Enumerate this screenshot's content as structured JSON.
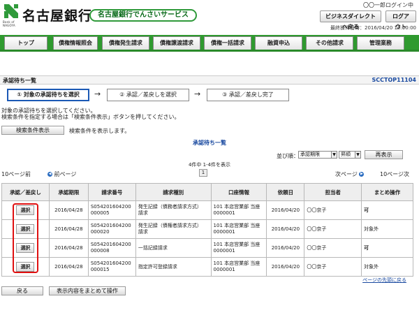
{
  "header": {
    "bank_name": "名古屋銀行",
    "logo_sub_en": "Bank of",
    "logo_sub_en2": "NAGOYA",
    "service_name": "名古屋銀行でんさいサービス",
    "user_line": "〇〇一郎ログイン中",
    "btn_business": "ビジネスダイレクトへ戻る",
    "btn_logout": "ログアウト",
    "last_operation": "最終操作日時：2016/04/20 10:00:00"
  },
  "nav": {
    "tabs": [
      "トップ",
      "債権情報照会",
      "債権発生請求",
      "債権譲渡請求",
      "債権一括請求",
      "融資申込",
      "その他請求",
      "管理業務"
    ]
  },
  "title": {
    "text": "承認待ち一覧",
    "screen_id": "SCCTOP11104"
  },
  "steps": {
    "step1": "① 対象の承認待ちを選択",
    "step2": "② 承認／差戻しを選択",
    "step3": "③ 承認／差戻し完了",
    "arrow": "→"
  },
  "instructions": {
    "line1": "対象の承認待ちを選択してください。",
    "line2": "検索条件を指定する場合は「検索条件表示」ボタンを押してください。"
  },
  "search": {
    "button": "検索条件表示",
    "note": "検索条件を表示します。"
  },
  "list": {
    "title": "承認待ち一覧",
    "sort_label": "並び順：",
    "sort_field": "承認期限",
    "sort_order": "昇順",
    "redisplay": "再表示",
    "count": "4件中 1-4件を表示",
    "page": "1",
    "prev10": "10ページ前",
    "prev": "前ページ",
    "next": "次ページ",
    "next10": "10ページ次",
    "columns": [
      "承認／差戻し",
      "承認期限",
      "請求番号",
      "請求種別",
      "口座情報",
      "依頼日",
      "担当者",
      "まとめ操作"
    ],
    "select_label": "選択",
    "rows": [
      {
        "deadline": "2016/04/28",
        "req_no1": "S054201604200",
        "req_no2": "000005",
        "type1": "発生記録（債務者請求方式）",
        "type2": "請求",
        "acct1": "101 本店営業部 当座",
        "acct2": "0000001",
        "date": "2016/04/20",
        "person": "〇〇京子",
        "batch": "可"
      },
      {
        "deadline": "2016/04/28",
        "req_no1": "S054201604200",
        "req_no2": "000020",
        "type1": "発生記録（債権者請求方式）",
        "type2": "請求",
        "acct1": "101 本店営業部 当座",
        "acct2": "0000001",
        "date": "2016/04/20",
        "person": "〇〇京子",
        "batch": "対象外"
      },
      {
        "deadline": "2016/04/28",
        "req_no1": "S054201604200",
        "req_no2": "000008",
        "type1": "一括記録請求",
        "type2": "",
        "acct1": "101 本店営業部 当座",
        "acct2": "0000001",
        "date": "2016/04/20",
        "person": "〇〇京子",
        "batch": "可"
      },
      {
        "deadline": "2016/04/28",
        "req_no1": "S054201604200",
        "req_no2": "000015",
        "type1": "指定許可登録請求",
        "type2": "",
        "acct1": "101 本店営業部 当座",
        "acct2": "0000001",
        "date": "2016/04/20",
        "person": "〇〇京子",
        "batch": "対象外"
      }
    ],
    "top_link": "ページの先頭に戻る"
  },
  "footer": {
    "back": "戻る",
    "batch_op": "表示内容をまとめて操作"
  },
  "colors": {
    "brand_green": "#2f9a2f",
    "link_blue": "#1a4aa0",
    "highlight_red": "#e01010"
  }
}
